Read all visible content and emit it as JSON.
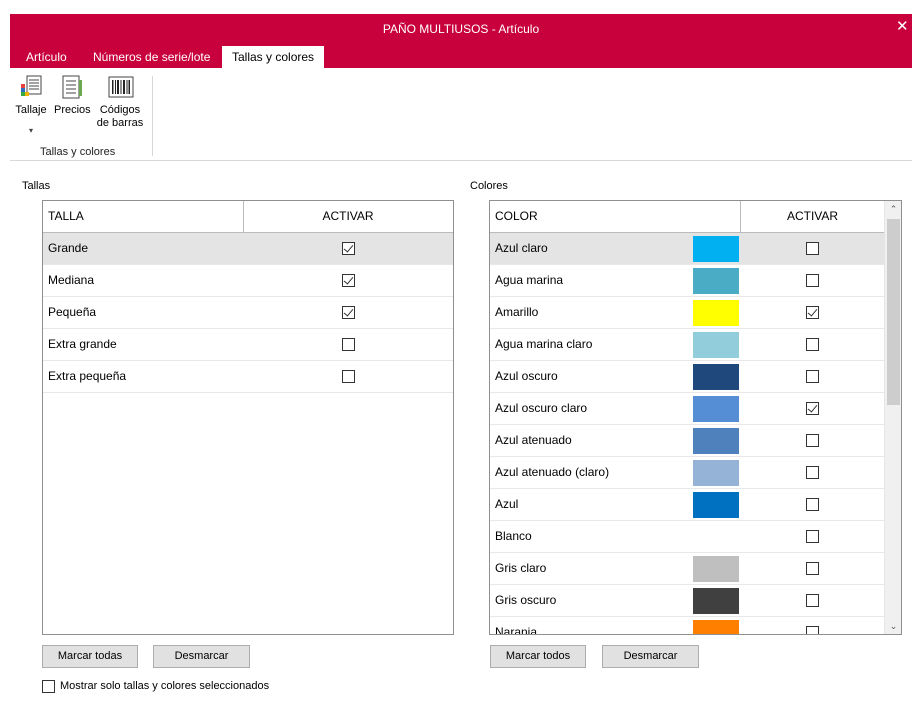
{
  "window": {
    "title": "PAÑO MULTIUSOS - Artículo",
    "close_glyph": "✕"
  },
  "tabs": [
    {
      "label": "Artículo",
      "active": false
    },
    {
      "label": "Números de serie/lote",
      "active": false
    },
    {
      "label": "Tallas y colores",
      "active": true
    }
  ],
  "ribbon": {
    "buttons": [
      {
        "label": "Tallaje",
        "icon": "size-chart-icon"
      },
      {
        "label": "Precios",
        "icon": "price-list-icon"
      },
      {
        "label": "Códigos de barras",
        "label_line1": "Códigos",
        "label_line2": "de barras",
        "icon": "barcode-icon"
      }
    ],
    "dropdown_glyph": "▾",
    "group_label": "Tallas y colores"
  },
  "tallas": {
    "section_label": "Tallas",
    "col_name": "TALLA",
    "col_active": "ACTIVAR",
    "rows": [
      {
        "name": "Grande",
        "checked": true,
        "selected": true
      },
      {
        "name": "Mediana",
        "checked": true,
        "selected": false
      },
      {
        "name": "Pequeña",
        "checked": true,
        "selected": false
      },
      {
        "name": "Extra grande",
        "checked": false,
        "selected": false
      },
      {
        "name": "Extra pequeña",
        "checked": false,
        "selected": false
      }
    ],
    "mark_all": "Marcar todas",
    "unmark": "Desmarcar"
  },
  "colores": {
    "section_label": "Colores",
    "col_name": "COLOR",
    "col_active": "ACTIVAR",
    "rows": [
      {
        "name": "Azul claro",
        "color": "#00b0f0",
        "checked": false,
        "selected": true
      },
      {
        "name": "Agua marina",
        "color": "#4bacc6",
        "checked": false,
        "selected": false
      },
      {
        "name": "Amarillo",
        "color": "#ffff00",
        "checked": true,
        "selected": false
      },
      {
        "name": "Agua marina claro",
        "color": "#92cddc",
        "checked": false,
        "selected": false
      },
      {
        "name": "Azul oscuro",
        "color": "#1f497d",
        "checked": false,
        "selected": false
      },
      {
        "name": "Azul oscuro claro",
        "color": "#558ed5",
        "checked": true,
        "selected": false
      },
      {
        "name": "Azul atenuado",
        "color": "#4f81bd",
        "checked": false,
        "selected": false
      },
      {
        "name": "Azul atenuado (claro)",
        "color": "#95b3d7",
        "checked": false,
        "selected": false
      },
      {
        "name": "Azul",
        "color": "#0070c0",
        "checked": false,
        "selected": false
      },
      {
        "name": "Blanco",
        "color": "#ffffff",
        "checked": false,
        "selected": false
      },
      {
        "name": "Gris claro",
        "color": "#bfbfbf",
        "checked": false,
        "selected": false
      },
      {
        "name": "Gris oscuro",
        "color": "#404040",
        "checked": false,
        "selected": false
      },
      {
        "name": "Naranja",
        "color": "#ff8000",
        "checked": false,
        "selected": false
      }
    ],
    "mark_all": "Marcar todos",
    "unmark": "Desmarcar"
  },
  "filter_label": "Mostrar solo tallas y colores seleccionados",
  "colors": {
    "accent": "#c8003c"
  }
}
